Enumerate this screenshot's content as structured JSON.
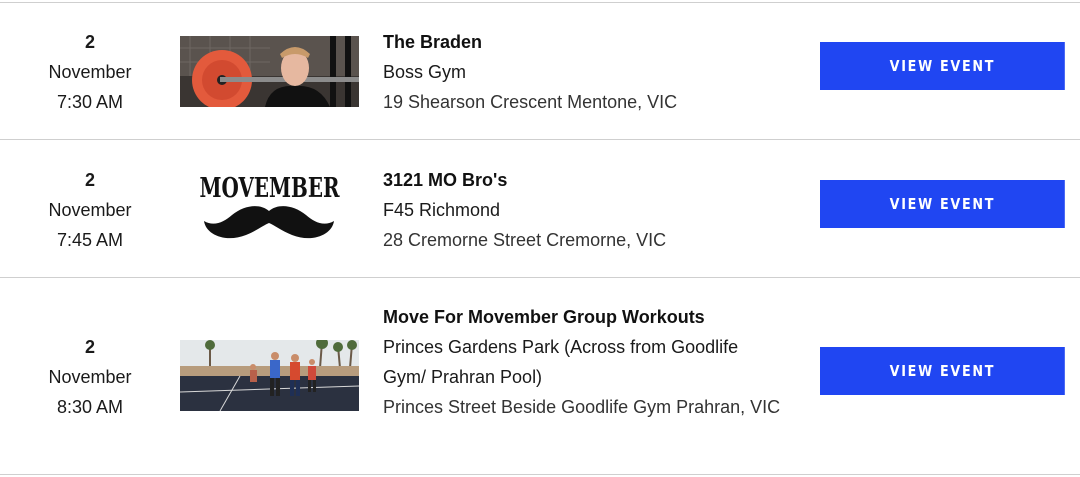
{
  "events": [
    {
      "day": "2",
      "month": "November",
      "time": "7:30 AM",
      "title": "The Braden",
      "venue": "Boss Gym",
      "address": "19 Shearson Crescent Mentone, VIC",
      "image": "gym-barbell-photo",
      "button": "VIEW EVENT"
    },
    {
      "day": "2",
      "month": "November",
      "time": "7:45 AM",
      "title": "3121 MO Bro's",
      "venue": "F45 Richmond",
      "address": "28 Cremorne Street Cremorne, VIC",
      "image": "movember-logo",
      "logo_text": "MOVEMBER",
      "button": "VIEW EVENT"
    },
    {
      "day": "2",
      "month": "November",
      "time": "8:30 AM",
      "title": "Move For Movember Group Workouts",
      "venue": "Princes Gardens Park (Across from Goodlife Gym/ Prahran Pool)",
      "address": "Princes Street Beside Goodlife Gym Prahran, VIC",
      "image": "outdoor-basketball-court-photo",
      "button": "VIEW EVENT"
    }
  ],
  "colors": {
    "button_bg": "#2046f2",
    "button_text": "#ffffff",
    "divider": "#cfcfcf"
  }
}
